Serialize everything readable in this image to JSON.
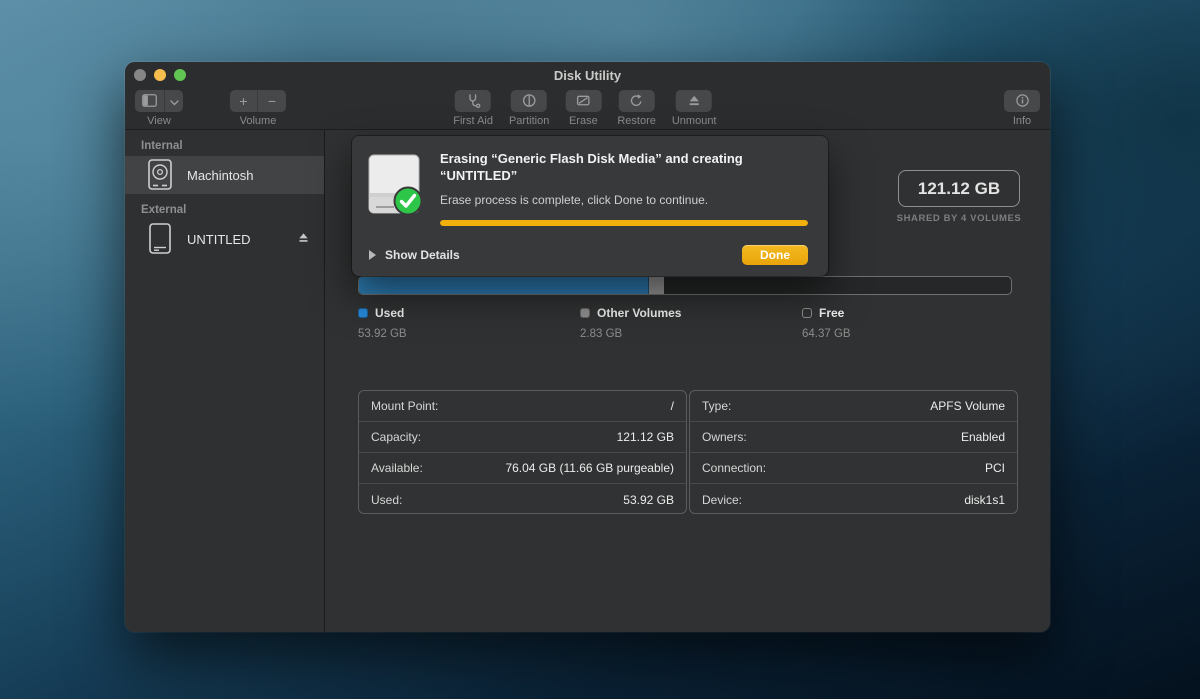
{
  "window": {
    "title": "Disk Utility"
  },
  "toolbar": {
    "view_label": "View",
    "volume_label": "Volume",
    "volume_plus": "+",
    "volume_minus": "−",
    "actions": [
      {
        "label": "First Aid",
        "icon": "stethoscope-icon"
      },
      {
        "label": "Partition",
        "icon": "partition-icon"
      },
      {
        "label": "Erase",
        "icon": "erase-icon"
      },
      {
        "label": "Restore",
        "icon": "restore-icon"
      },
      {
        "label": "Unmount",
        "icon": "eject-icon"
      }
    ],
    "info_label": "Info"
  },
  "sidebar": {
    "sections": [
      {
        "header": "Internal",
        "items": [
          {
            "name": "Machintosh",
            "selected": true
          }
        ]
      },
      {
        "header": "External",
        "items": [
          {
            "name": "UNTITLED",
            "selected": false,
            "eject": true
          }
        ]
      }
    ]
  },
  "dialog": {
    "title_line1": "Erasing “Generic Flash Disk Media” and creating",
    "title_line2": "“UNTITLED”",
    "message": "Erase process is complete, click Done to continue.",
    "progress_percent": 100,
    "progress_color": "#F2B00D",
    "show_details_label": "Show Details",
    "done_label": "Done",
    "status": "complete",
    "status_color": "#2EC648"
  },
  "main": {
    "capacity_value": "121.12 GB",
    "capacity_subtitle": "SHARED BY 4 VOLUMES",
    "usage_bar": {
      "segments": [
        {
          "name": "Used",
          "percent": 44.5,
          "color": "#2E7FB6"
        },
        {
          "name": "Other Volumes",
          "percent": 2.3,
          "color": "#9A9A9A"
        },
        {
          "name": "Free",
          "percent": 53.2,
          "color": "transparent"
        }
      ]
    },
    "legend": [
      {
        "label": "Used",
        "value": "53.92 GB",
        "swatch_color": "#2787D8",
        "swatch_style": "filled"
      },
      {
        "label": "Other Volumes",
        "value": "2.83 GB",
        "swatch_color": "#8E8E8E",
        "swatch_style": "filled"
      },
      {
        "label": "Free",
        "value": "64.37 GB",
        "swatch_color": "transparent",
        "swatch_style": "outline"
      }
    ],
    "details_left": [
      {
        "label": "Mount Point:",
        "value": "/"
      },
      {
        "label": "Capacity:",
        "value": "121.12 GB"
      },
      {
        "label": "Available:",
        "value": "76.04 GB (11.66 GB purgeable)"
      },
      {
        "label": "Used:",
        "value": "53.92 GB"
      }
    ],
    "details_right": [
      {
        "label": "Type:",
        "value": "APFS Volume"
      },
      {
        "label": "Owners:",
        "value": "Enabled"
      },
      {
        "label": "Connection:",
        "value": "PCI"
      },
      {
        "label": "Device:",
        "value": "disk1s1"
      }
    ]
  }
}
